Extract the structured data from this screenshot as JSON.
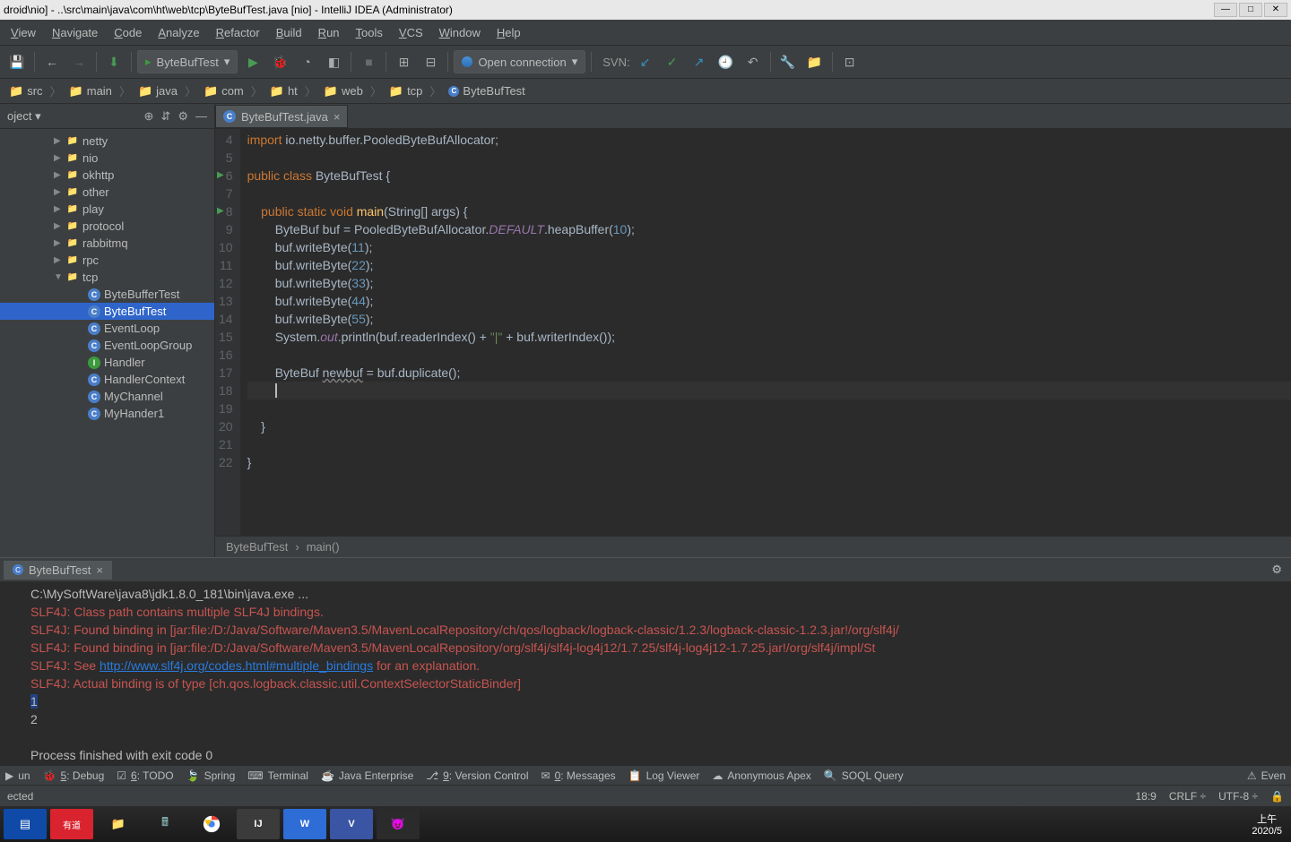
{
  "title": "droid\\nio] - ..\\src\\main\\java\\com\\ht\\web\\tcp\\ByteBufTest.java [nio] - IntelliJ IDEA (Administrator)",
  "menu": [
    "View",
    "Navigate",
    "Code",
    "Analyze",
    "Refactor",
    "Build",
    "Run",
    "Tools",
    "VCS",
    "Window",
    "Help"
  ],
  "run_config": "ByteBufTest",
  "open_connection": "Open connection",
  "svn_label": "SVN:",
  "breadcrumb": [
    "src",
    "main",
    "java",
    "com",
    "ht",
    "web",
    "tcp",
    "ByteBufTest"
  ],
  "project_label": "oject",
  "tree": [
    {
      "depth": 1,
      "arrow": "▶",
      "icon": "folder",
      "label": "netty"
    },
    {
      "depth": 1,
      "arrow": "▶",
      "icon": "folder",
      "label": "nio"
    },
    {
      "depth": 1,
      "arrow": "▶",
      "icon": "folder",
      "label": "okhttp"
    },
    {
      "depth": 1,
      "arrow": "▶",
      "icon": "folder",
      "label": "other"
    },
    {
      "depth": 1,
      "arrow": "▶",
      "icon": "folder",
      "label": "play"
    },
    {
      "depth": 1,
      "arrow": "▶",
      "icon": "folder",
      "label": "protocol"
    },
    {
      "depth": 1,
      "arrow": "▶",
      "icon": "folder",
      "label": "rabbitmq"
    },
    {
      "depth": 1,
      "arrow": "▶",
      "icon": "folder",
      "label": "rpc"
    },
    {
      "depth": 1,
      "arrow": "▼",
      "icon": "folder",
      "label": "tcp"
    },
    {
      "depth": 2,
      "arrow": "",
      "icon": "c",
      "label": "ByteBufferTest"
    },
    {
      "depth": 2,
      "arrow": "",
      "icon": "c",
      "label": "ByteBufTest",
      "sel": true
    },
    {
      "depth": 2,
      "arrow": "",
      "icon": "c",
      "label": "EventLoop"
    },
    {
      "depth": 2,
      "arrow": "",
      "icon": "c",
      "label": "EventLoopGroup"
    },
    {
      "depth": 2,
      "arrow": "",
      "icon": "i",
      "label": "Handler"
    },
    {
      "depth": 2,
      "arrow": "",
      "icon": "c",
      "label": "HandlerContext"
    },
    {
      "depth": 2,
      "arrow": "",
      "icon": "c",
      "label": "MyChannel"
    },
    {
      "depth": 2,
      "arrow": "",
      "icon": "c",
      "label": "MyHander1"
    }
  ],
  "editor_tab": "ByteBufTest.java",
  "line_start": 4,
  "crumb": {
    "class": "ByteBufTest",
    "method": "main()"
  },
  "run_tab": "ByteBufTest",
  "console": [
    {
      "t": "C:\\MySoftWare\\java8\\jdk1.8.0_181\\bin\\java.exe ...",
      "cls": ""
    },
    {
      "t": "SLF4J: Class path contains multiple SLF4J bindings.",
      "cls": "err"
    },
    {
      "t": "SLF4J: Found binding in [jar:file:/D:/Java/Software/Maven3.5/MavenLocalRepository/ch/qos/logback/logback-classic/1.2.3/logback-classic-1.2.3.jar!/org/slf4j/",
      "cls": "err"
    },
    {
      "t": "SLF4J: Found binding in [jar:file:/D:/Java/Software/Maven3.5/MavenLocalRepository/org/slf4j/slf4j-log4j12/1.7.25/slf4j-log4j12-1.7.25.jar!/org/slf4j/impl/St",
      "cls": "err"
    },
    {
      "pre": "SLF4J: See ",
      "link": "http://www.slf4j.org/codes.html#multiple_bindings",
      "post": " for an explanation.",
      "cls": "err"
    },
    {
      "t": "SLF4J: Actual binding is of type [ch.qos.logback.classic.util.ContextSelectorStaticBinder]",
      "cls": "err"
    },
    {
      "t": "1",
      "cls": "",
      "hl": true
    },
    {
      "t": "2",
      "cls": ""
    },
    {
      "t": "",
      "cls": ""
    },
    {
      "t": "Process finished with exit code 0",
      "cls": ""
    }
  ],
  "bottom_tabs": [
    "un",
    "5: Debug",
    "6: TODO",
    "Spring",
    "Terminal",
    "Java Enterprise",
    "9: Version Control",
    "0: Messages",
    "Log Viewer",
    "Anonymous Apex",
    "SOQL Query",
    "Even"
  ],
  "status2_left": "ected",
  "status2": {
    "pos": "18:9",
    "eol": "CRLF",
    "enc": "UTF-8"
  },
  "clock": {
    "l1": "上午",
    "l2": "2020/5"
  }
}
